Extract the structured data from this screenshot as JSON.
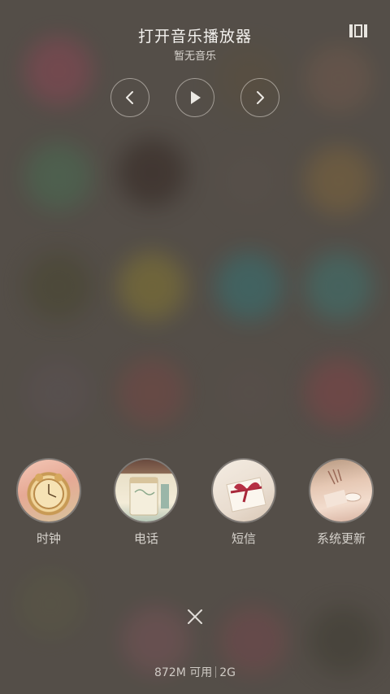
{
  "music": {
    "title": "打开音乐播放器",
    "subtitle": "暂无音乐"
  },
  "controls": {
    "prev_icon": "chevron-left-icon",
    "play_icon": "play-icon",
    "next_icon": "chevron-right-icon"
  },
  "apps": [
    {
      "label": "时钟",
      "icon": "clock-photo"
    },
    {
      "label": "电话",
      "icon": "phone-photo"
    },
    {
      "label": "短信",
      "icon": "message-photo"
    },
    {
      "label": "系统更新",
      "icon": "system-update-photo"
    }
  ],
  "memory": {
    "available": "872M 可用",
    "total": "2G"
  },
  "colors": {
    "background": "#5c5650",
    "text": "#f3f1ee",
    "muted_text": "#d6d2cc"
  }
}
